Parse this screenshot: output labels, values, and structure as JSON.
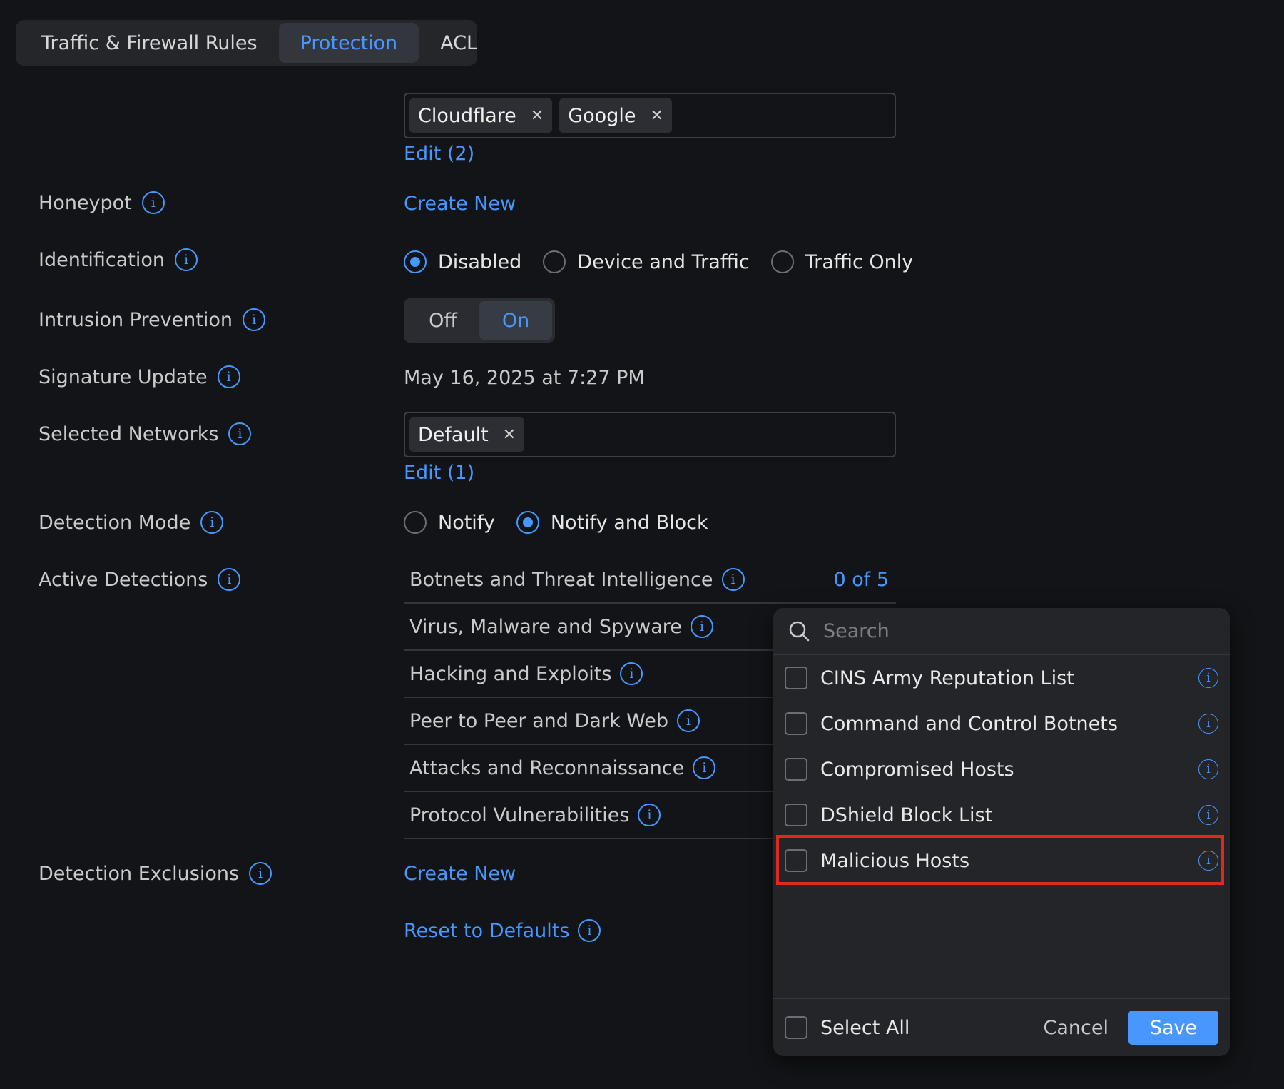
{
  "tabs": [
    {
      "label": "Traffic & Firewall Rules"
    },
    {
      "label": "Protection"
    },
    {
      "label": "ACL"
    }
  ],
  "dns_providers": {
    "tags": [
      "Cloudflare",
      "Google"
    ],
    "edit_label": "Edit (2)"
  },
  "honeypot": {
    "label": "Honeypot",
    "action": "Create New"
  },
  "identification": {
    "label": "Identification",
    "options": [
      "Disabled",
      "Device and Traffic",
      "Traffic Only"
    ],
    "selected": "Disabled"
  },
  "intrusion_prevention": {
    "label": "Intrusion Prevention",
    "off": "Off",
    "on": "On",
    "selected": "On"
  },
  "signature_update": {
    "label": "Signature Update",
    "value": "May 16, 2025 at 7:27 PM"
  },
  "selected_networks": {
    "label": "Selected Networks",
    "tags": [
      "Default"
    ],
    "edit_label": "Edit (1)"
  },
  "detection_mode": {
    "label": "Detection Mode",
    "options": [
      "Notify",
      "Notify and Block"
    ],
    "selected": "Notify and Block"
  },
  "active_detections": {
    "label": "Active Detections",
    "rows": [
      {
        "name": "Botnets and Threat Intelligence",
        "count": "0 of 5"
      },
      {
        "name": "Virus, Malware and Spyware"
      },
      {
        "name": "Hacking and Exploits"
      },
      {
        "name": "Peer to Peer and Dark Web"
      },
      {
        "name": "Attacks and Reconnaissance"
      },
      {
        "name": "Protocol Vulnerabilities"
      }
    ]
  },
  "detection_exclusions": {
    "label": "Detection Exclusions",
    "action": "Create New"
  },
  "reset": {
    "label": "Reset to Defaults"
  },
  "popover": {
    "search_placeholder": "Search",
    "items": [
      {
        "label": "CINS Army Reputation List",
        "checked": false
      },
      {
        "label": "Command and Control Botnets",
        "checked": false
      },
      {
        "label": "Compromised Hosts",
        "checked": false
      },
      {
        "label": "DShield Block List",
        "checked": false
      },
      {
        "label": "Malicious Hosts",
        "checked": false
      }
    ],
    "select_all": "Select All",
    "cancel": "Cancel",
    "save": "Save"
  },
  "colors": {
    "accent": "#4797ff",
    "background": "#131417",
    "highlight": "#e0281b"
  },
  "icons": [
    "info-icon",
    "close-icon",
    "search-icon"
  ]
}
